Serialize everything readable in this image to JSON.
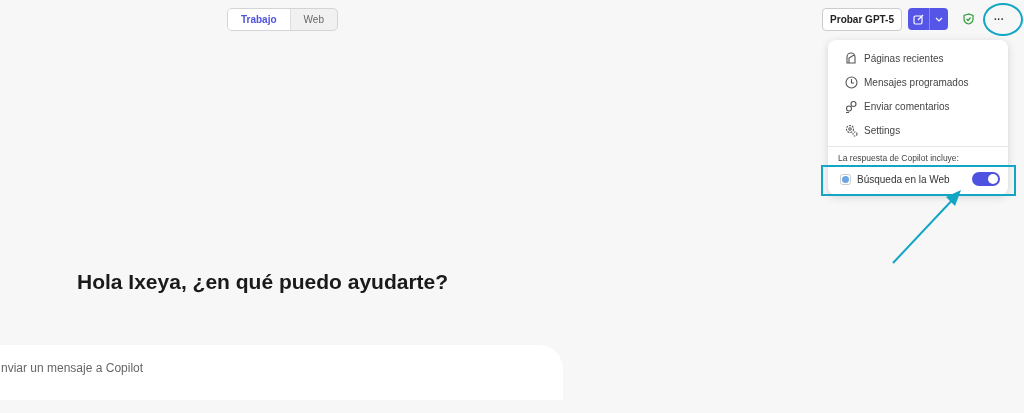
{
  "mode_tabs": [
    {
      "label": "Trabajo",
      "selected": true
    },
    {
      "label": "Web",
      "selected": false
    }
  ],
  "try_button": "Probar GPT-5",
  "more_button": "···",
  "menu": {
    "items": [
      {
        "label": "Páginas recientes"
      },
      {
        "label": "Mensajes programados"
      },
      {
        "label": "Enviar comentarios"
      },
      {
        "label": "Settings"
      }
    ],
    "section_title": "La respuesta de Copilot incluye:",
    "web_search": {
      "label": "Búsqueda en la Web",
      "on": true
    }
  },
  "greeting": "Hola Ixeya, ¿en qué puedo ayudarte?",
  "composer": {
    "placeholder": "nviar un mensaje a Copilot"
  }
}
